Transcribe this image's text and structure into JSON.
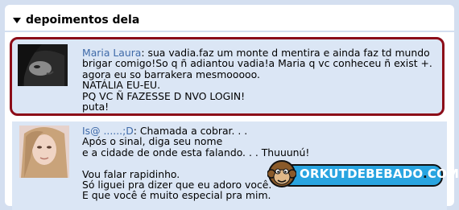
{
  "section": {
    "title": "depoimentos dela",
    "expand_icon": "triangle-down-icon"
  },
  "testimonials": [
    {
      "author": "Maria Laura",
      "lines": [
        ": sua vadia.faz um monte d mentira e ainda faz td mundo",
        "brigar comigo!So q ñ adiantou vadia!a Maria q vc conheceu ñ exist +.",
        "agora eu so barrakera mesmooooo.",
        "NATÁLIA EU-EU.",
        "PQ VC Ñ FAZESSE D NVO LOGIN!",
        "puta!"
      ],
      "highlight_color": "#8c0c18"
    },
    {
      "author": "Is@ ......;D",
      "lines": [
        ": Chamada a cobrar. . .",
        "Após o sinal, diga seu nome",
        "e a cidade de onde esta falando. . . Thuuunú!",
        "",
        "Vou falar rapidinho.",
        "Só liguei pra dizer que eu adoro você.",
        "E que você é muito especial pra mim."
      ]
    }
  ],
  "watermark": {
    "brand": "ORKUTDEBEBADO",
    "dot": ".",
    "tld": "COM",
    "icon": "monkey-mascot-icon",
    "color": "#29a4e0"
  }
}
